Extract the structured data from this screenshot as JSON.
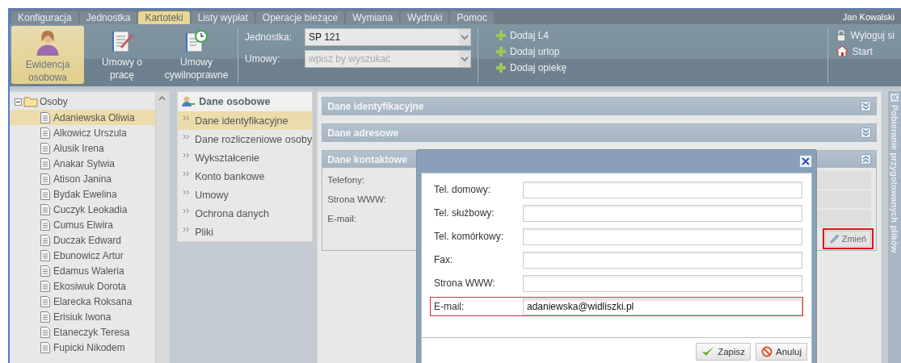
{
  "menu_tabs": [
    {
      "label": "Konfiguracja",
      "selected": false
    },
    {
      "label": "Jednostka",
      "selected": false
    },
    {
      "label": "Kartoteki",
      "selected": true
    },
    {
      "label": "Listy wypłat",
      "selected": false
    },
    {
      "label": "Operacje bieżące",
      "selected": false
    },
    {
      "label": "Wymiana",
      "selected": false
    },
    {
      "label": "Wydruki",
      "selected": false
    },
    {
      "label": "Pomoc",
      "selected": false
    }
  ],
  "user": "Jan Kowalski",
  "ribbon": {
    "big_buttons": [
      {
        "label": "Ewidencja osobowa",
        "selected": true
      },
      {
        "label": "Umowy o pracę",
        "selected": false
      },
      {
        "label": "Umowy cywilnoprawne",
        "selected": false
      }
    ],
    "filters": [
      {
        "label": "Jednostka:",
        "value": "SP 121"
      },
      {
        "label": "Umowy:",
        "placeholder": "wpisz by wyszukać"
      }
    ],
    "actions": [
      "Dodaj L4",
      "Dodaj urlop",
      "Dodaj opiekę"
    ],
    "session": [
      "Wyloguj si",
      "Start"
    ]
  },
  "tree": {
    "label": "Osoby",
    "expanded": true,
    "children": [
      {
        "label": "Adaniewska Oliwia",
        "selected": true
      },
      {
        "label": "Alkowicz Urszula",
        "selected": false
      },
      {
        "label": "Alusik Irena",
        "selected": false
      },
      {
        "label": "Anakar Sylwia",
        "selected": false
      },
      {
        "label": "Atison Janina",
        "selected": false
      },
      {
        "label": "Bydak Ewelina",
        "selected": false
      },
      {
        "label": "Cuczyk Leokadia",
        "selected": false
      },
      {
        "label": "Cumus Elwira",
        "selected": false
      },
      {
        "label": "Duczak Edward",
        "selected": false
      },
      {
        "label": "Ebunowicz Artur",
        "selected": false
      },
      {
        "label": "Edamus Waleria",
        "selected": false
      },
      {
        "label": "Ekosiwuk Dorota",
        "selected": false
      },
      {
        "label": "Elarecka Roksana",
        "selected": false
      },
      {
        "label": "Erisiuk Iwona",
        "selected": false
      },
      {
        "label": "Etaneczyk Teresa",
        "selected": false
      },
      {
        "label": "Fupicki Nikodem",
        "selected": false
      }
    ]
  },
  "nav": {
    "title": "Dane osobowe",
    "items": [
      {
        "label": "Dane identyfikacyjne",
        "selected": true
      },
      {
        "label": "Dane rozliczeniowe osoby",
        "selected": false
      },
      {
        "label": "Wykształcenie",
        "selected": false
      },
      {
        "label": "Konto bankowe",
        "selected": false
      },
      {
        "label": "Umowy",
        "selected": false
      },
      {
        "label": "Ochrona danych",
        "selected": false
      },
      {
        "label": "Pliki",
        "selected": false
      }
    ]
  },
  "sections": [
    {
      "title": "Dane identyfikacyjne",
      "expanded": false
    },
    {
      "title": "Dane adresowe",
      "expanded": false
    },
    {
      "title": "Dane kontaktowe",
      "expanded": true,
      "fields": [
        "Telefony:",
        "Strona WWW:",
        "E-mail:"
      ],
      "button": {
        "label": "Zmień",
        "highlighted": true
      }
    }
  ],
  "side_strip": {
    "title": "Pobieranie przygotowanych plików"
  },
  "dialog": {
    "fields": [
      {
        "label": "Tel. domowy:",
        "highlighted": false
      },
      {
        "label": "Tel. służbowy:",
        "highlighted": false
      },
      {
        "label": "Tel. komórkowy:",
        "highlighted": false
      },
      {
        "label": "Fax:",
        "highlighted": false
      },
      {
        "label": "Strona WWW:",
        "highlighted": false
      },
      {
        "label": "E-mail:",
        "value": "adaniewska@widliszki.pl",
        "highlighted": true
      }
    ],
    "buttons": [
      {
        "label": "Zapisz",
        "kind": "save"
      },
      {
        "label": "Anuluj",
        "kind": "cancel"
      }
    ]
  }
}
